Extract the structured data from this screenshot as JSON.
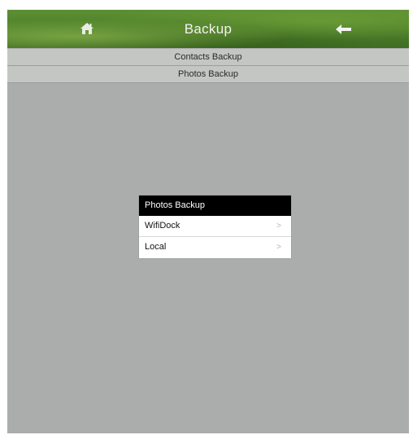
{
  "header": {
    "title": "Backup",
    "home_icon": "home-icon",
    "back_icon": "arrow-left-icon"
  },
  "menu": {
    "items": [
      {
        "label": "Contacts Backup"
      },
      {
        "label": "Photos Backup"
      }
    ]
  },
  "popup": {
    "title": "Photos Backup",
    "options": [
      {
        "label": "WifiDock",
        "chevron": ">"
      },
      {
        "label": "Local",
        "chevron": ">"
      }
    ]
  },
  "colors": {
    "header_green": "#4d7f2a",
    "background_gray": "#aaadab",
    "popup_header": "#000000"
  }
}
